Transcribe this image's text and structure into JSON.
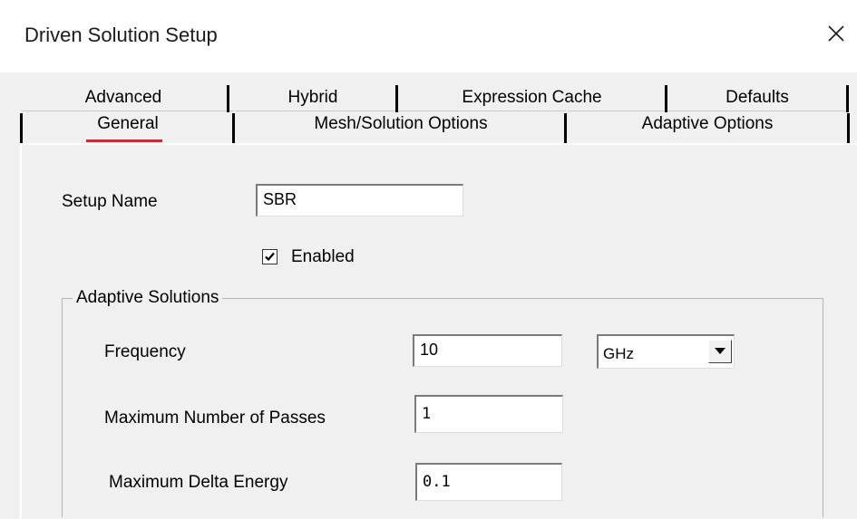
{
  "window": {
    "title": "Driven Solution Setup",
    "close_icon": "close-icon"
  },
  "tabs": {
    "back_row": [
      "Advanced",
      "Hybrid",
      "Expression Cache",
      "Defaults"
    ],
    "front_row": [
      "General",
      "Mesh/Solution Options",
      "Adaptive Options"
    ],
    "active": "General",
    "active_underline_color": "#d9242b"
  },
  "general": {
    "setup_name_label": "Setup Name",
    "setup_name_value": "SBR",
    "enabled_label": "Enabled",
    "enabled_checked": true
  },
  "adaptive": {
    "legend": "Adaptive Solutions",
    "frequency_label": "Frequency",
    "frequency_value": "10",
    "frequency_unit": "GHz",
    "max_passes_label": "Maximum Number of Passes",
    "max_passes_value": "1",
    "max_delta_label": "Maximum Delta Energy",
    "max_delta_value": "0.1"
  }
}
